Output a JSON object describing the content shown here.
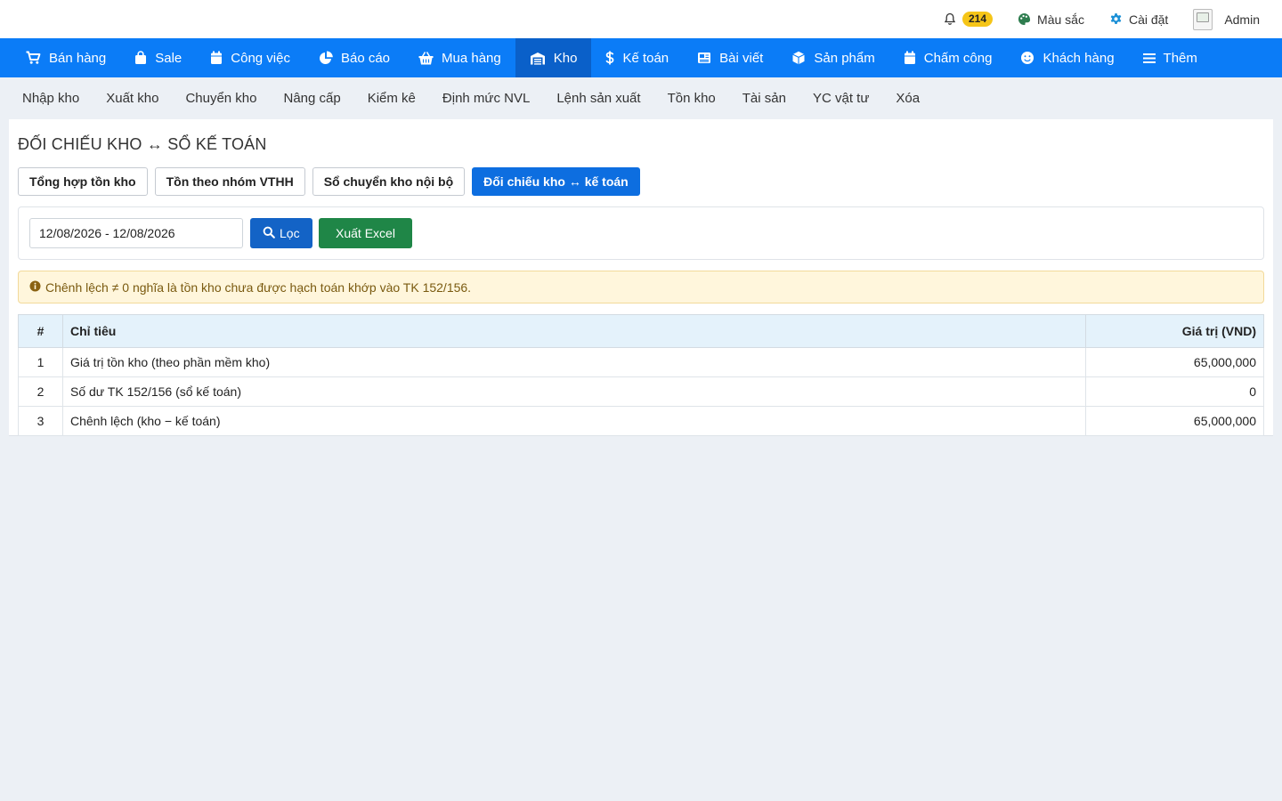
{
  "topbar": {
    "notification_count": "214",
    "color_label": "Màu sắc",
    "settings_label": "Cài đặt",
    "user_label": "Admin"
  },
  "mainnav": {
    "items": [
      {
        "label": "Bán hàng",
        "icon": "cart-icon"
      },
      {
        "label": "Sale",
        "icon": "bag-icon"
      },
      {
        "label": "Công việc",
        "icon": "calendar-icon"
      },
      {
        "label": "Báo cáo",
        "icon": "pie-chart-icon"
      },
      {
        "label": "Mua hàng",
        "icon": "basket-icon"
      },
      {
        "label": "Kho",
        "icon": "warehouse-icon",
        "active": true
      },
      {
        "label": "Kế toán",
        "icon": "dollar-icon"
      },
      {
        "label": "Bài viết",
        "icon": "newspaper-icon"
      },
      {
        "label": "Sản phẩm",
        "icon": "box-icon"
      },
      {
        "label": "Chấm công",
        "icon": "calendar-icon"
      },
      {
        "label": "Khách hàng",
        "icon": "smile-icon"
      },
      {
        "label": "Thêm",
        "icon": "menu-icon"
      }
    ]
  },
  "subnav": {
    "items": [
      "Nhập kho",
      "Xuất kho",
      "Chuyển kho",
      "Nâng cấp",
      "Kiểm kê",
      "Định mức NVL",
      "Lệnh sản xuất",
      "Tồn kho",
      "Tài sản",
      "YC vật tư",
      "Xóa"
    ]
  },
  "page": {
    "title": "ĐỐI CHIẾU KHO ↔ SỔ KẾ TOÁN",
    "tabs": [
      {
        "label": "Tổng hợp tồn kho"
      },
      {
        "label": "Tồn theo nhóm VTHH"
      },
      {
        "label": "Sổ chuyển kho nội bộ"
      },
      {
        "label": "Đối chiếu kho ↔ kế toán",
        "active": true
      }
    ],
    "filter": {
      "date_range": "12/08/2026 - 12/08/2026",
      "filter_button": "Lọc",
      "export_button": "Xuất Excel"
    },
    "alert_text": "Chênh lệch ≠ 0 nghĩa là tồn kho chưa được hạch toán khớp vào TK 152/156.",
    "table": {
      "headers": [
        "#",
        "Chỉ tiêu",
        "Giá trị (VND)"
      ],
      "rows": [
        {
          "idx": "1",
          "name": "Giá trị tồn kho (theo phần mềm kho)",
          "value": "65,000,000"
        },
        {
          "idx": "2",
          "name": "Số dư TK 152/156 (sổ kế toán)",
          "value": "0"
        },
        {
          "idx": "3",
          "name": "Chênh lệch (kho − kế toán)",
          "value": "65,000,000"
        }
      ]
    }
  },
  "colors": {
    "nav_bg": "#0b7cf7",
    "nav_active": "#0a60c9",
    "primary_button": "#1363c6",
    "excel_button": "#1f8647",
    "badge": "#f5c518"
  }
}
